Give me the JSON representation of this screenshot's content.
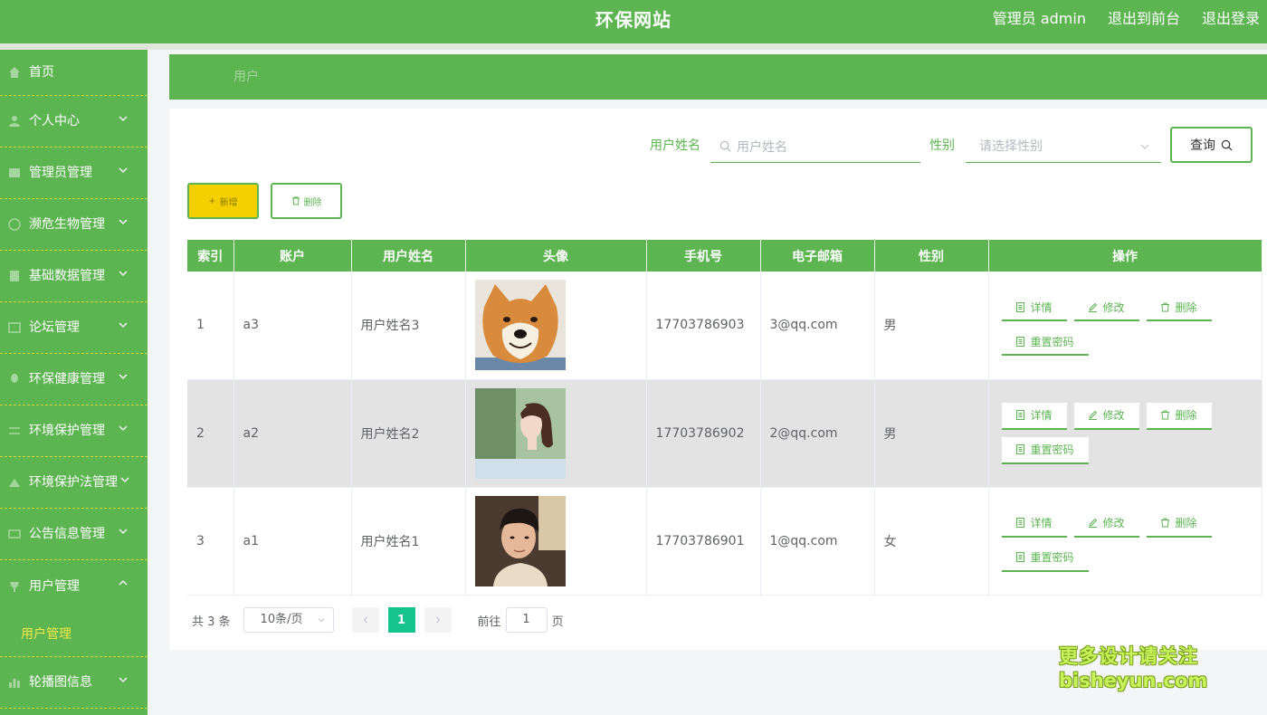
{
  "header": {
    "site_title": "环保网站",
    "admin_label": "管理员 admin",
    "back_to_front": "退出到前台",
    "logout": "退出登录"
  },
  "sidebar": {
    "items": [
      {
        "label": "首页",
        "icon": "home-icon"
      },
      {
        "label": "个人中心",
        "icon": "user-icon"
      },
      {
        "label": "管理员管理",
        "icon": "admin-icon"
      },
      {
        "label": "濒危生物管理",
        "icon": "globe-icon"
      },
      {
        "label": "基础数据管理",
        "icon": "database-icon"
      },
      {
        "label": "论坛管理",
        "icon": "forum-icon"
      },
      {
        "label": "环保健康管理",
        "icon": "leaf-icon"
      },
      {
        "label": "环境保护管理",
        "icon": "settings-icon"
      },
      {
        "label": "环境保护法管理",
        "icon": "law-icon"
      },
      {
        "label": "公告信息管理",
        "icon": "notice-icon"
      },
      {
        "label": "用户管理",
        "icon": "users-icon"
      },
      {
        "label": "轮播图信息",
        "icon": "chart-icon"
      }
    ],
    "open_sub_item": "用户管理"
  },
  "breadcrumb": {
    "current": "用户"
  },
  "search": {
    "name_label": "用户姓名",
    "name_placeholder": "用户姓名",
    "gender_label": "性别",
    "gender_placeholder": "请选择性别",
    "query_button": "查询"
  },
  "actions": {
    "add": "新增",
    "delete": "删除"
  },
  "table": {
    "headers": [
      "索引",
      "账户",
      "用户姓名",
      "头像",
      "手机号",
      "电子邮箱",
      "性别",
      "操作"
    ],
    "rows": [
      {
        "index": "1",
        "account": "a3",
        "name": "用户姓名3",
        "avatar": "shiba-dog-photo",
        "phone": "17703786903",
        "email": "3@qq.com",
        "gender": "男"
      },
      {
        "index": "2",
        "account": "a2",
        "name": "用户姓名2",
        "avatar": "girl-profile-photo",
        "phone": "17703786902",
        "email": "2@qq.com",
        "gender": "男"
      },
      {
        "index": "3",
        "account": "a1",
        "name": "用户姓名1",
        "avatar": "boy-portrait-photo",
        "phone": "17703786901",
        "email": "1@qq.com",
        "gender": "女"
      }
    ],
    "row_actions": {
      "detail": "详情",
      "edit": "修改",
      "delete": "删除",
      "reset_password": "重置密码"
    }
  },
  "pagination": {
    "total_text": "共 3 条",
    "page_size": "10条/页",
    "current_page": "1",
    "goto_prefix": "前往",
    "goto_value": "1",
    "goto_suffix": "页"
  },
  "watermark": {
    "line1": "更多设计请关注",
    "line2": "bisheyun.com"
  },
  "colors": {
    "primary": "#5cb551",
    "add_button": "#f5d000",
    "active_page": "#14c48c",
    "sub_item_text": "#f5e74a"
  }
}
